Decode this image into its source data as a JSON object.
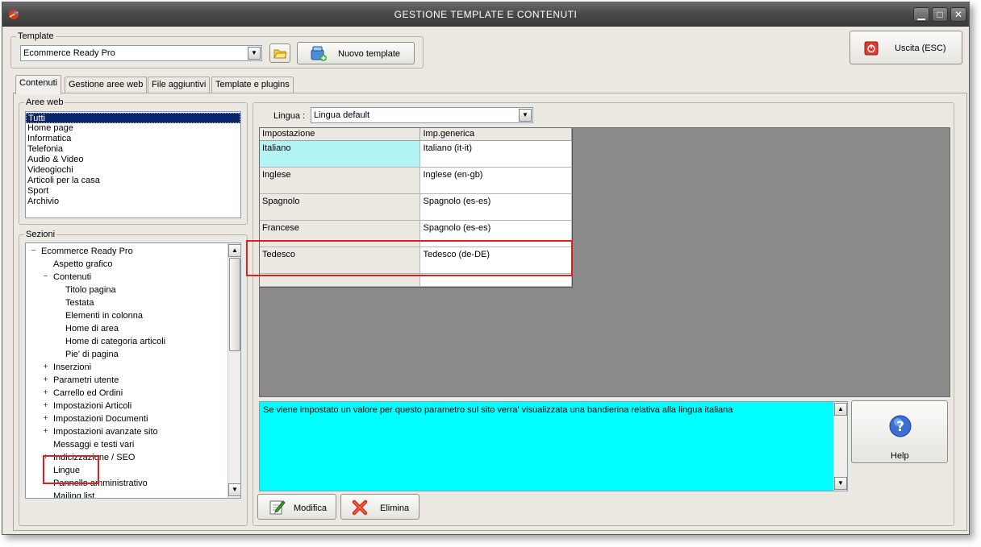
{
  "window": {
    "title": "GESTIONE TEMPLATE E CONTENUTI",
    "minimize": "▁",
    "maximize": "□",
    "close": "✕"
  },
  "template": {
    "legend": "Template",
    "selected": "Ecommerce Ready Pro",
    "new_button": "Nuovo template"
  },
  "exit_button": "Uscita (ESC)",
  "tabs": [
    {
      "label": "Contenuti",
      "active": true
    },
    {
      "label": "Gestione aree web"
    },
    {
      "label": "File aggiuntivi"
    },
    {
      "label": "Template e plugins"
    }
  ],
  "aree_web": {
    "legend": "Aree web",
    "items": [
      "Tutti",
      "Home page",
      "Informatica",
      "Telefonia",
      "Audio & Video",
      "Videogiochi",
      "Articoli per la casa",
      "Sport",
      "Archivio"
    ],
    "selected": 0
  },
  "sezioni": {
    "legend": "Sezioni",
    "items": [
      {
        "label": "Ecommerce Ready Pro",
        "toggle": "−"
      },
      {
        "label": "Aspetto grafico",
        "toggle": ""
      },
      {
        "label": "Contenuti",
        "toggle": "−"
      },
      {
        "label": "Titolo pagina",
        "toggle": ""
      },
      {
        "label": "Testata",
        "toggle": ""
      },
      {
        "label": "Elementi in colonna",
        "toggle": ""
      },
      {
        "label": "Home di area",
        "toggle": ""
      },
      {
        "label": "Home di categoria articoli",
        "toggle": ""
      },
      {
        "label": "Pie' di pagina",
        "toggle": ""
      },
      {
        "label": "Inserzioni",
        "toggle": "+"
      },
      {
        "label": "Parametri utente",
        "toggle": "+"
      },
      {
        "label": "Carrello ed Ordini",
        "toggle": "+"
      },
      {
        "label": "Impostazioni Articoli",
        "toggle": "+"
      },
      {
        "label": "Impostazioni Documenti",
        "toggle": "+"
      },
      {
        "label": "Impostazioni avanzate sito",
        "toggle": "+"
      },
      {
        "label": "Messaggi e testi vari",
        "toggle": ""
      },
      {
        "label": "Indicizzazione / SEO",
        "toggle": "+"
      },
      {
        "label": "Lingue",
        "toggle": ""
      },
      {
        "label": "Pannello amministrativo",
        "toggle": ""
      },
      {
        "label": "Mailing list",
        "toggle": ""
      }
    ]
  },
  "lingua": {
    "label": "Lingua :",
    "selected": "Lingua default"
  },
  "grid": {
    "columns": [
      "Impostazione",
      "Imp.generica"
    ],
    "rows": [
      [
        "Italiano",
        "Italiano (it-it)"
      ],
      [
        "Inglese",
        "Inglese (en-gb)"
      ],
      [
        "Spagnolo",
        "Spagnolo (es-es)"
      ],
      [
        "Francese",
        "Spagnolo (es-es)"
      ],
      [
        "Tedesco",
        "Tedesco (de-DE)"
      ],
      [
        "",
        ""
      ]
    ]
  },
  "description": "Se viene impostato un valore per questo parametro sul sito verra' visualizzata una bandierina relativa alla lingua italiana",
  "help_button": "Help",
  "modifica_button": "Modifica",
  "elimina_button": "Elimina",
  "icons": {
    "app": "app-icon",
    "folder": "folder-icon",
    "new_template": "new-template-icon",
    "exit": "exit-icon",
    "help": "help-icon",
    "edit": "edit-icon",
    "delete": "delete-icon"
  },
  "colors": {
    "selection": "#0a246a",
    "description_bg": "#00ffff",
    "selected_row": "#b2f4f4",
    "highlight": "#e02020"
  }
}
